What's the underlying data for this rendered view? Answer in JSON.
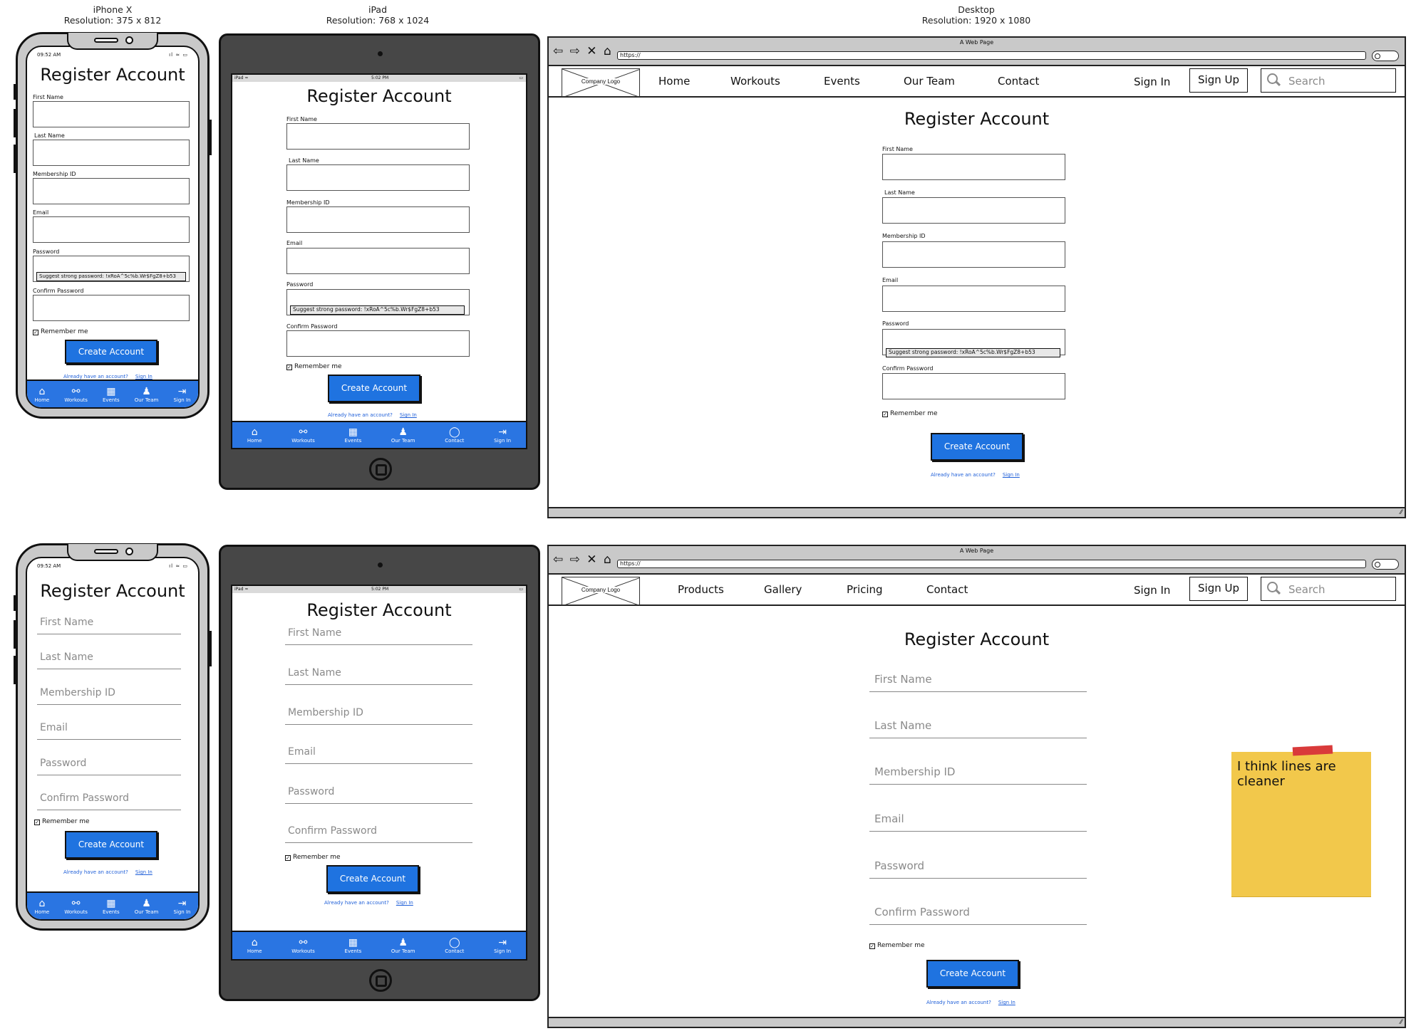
{
  "headers": {
    "iphone": {
      "name": "iPhone X",
      "res": "Resolution: 375 x 812"
    },
    "ipad": {
      "name": "iPad",
      "res": "Resolution: 768 x 1024"
    },
    "desktop": {
      "name": "Desktop",
      "res": "Resolution: 1920 x 1080"
    }
  },
  "form": {
    "title": "Register Account",
    "labels": [
      "First Name",
      "Last Name",
      "Membership ID",
      "Email",
      "Password",
      "Confirm Password"
    ],
    "password_suggestion": "Suggest strong password: !xRoA^5c%b.Wr$FgZ8+b53",
    "remember_me": "Remember me",
    "checkmark": "✓",
    "create_button": "Create Account",
    "already": "Already have an account?",
    "sign_in_link": "Sign In"
  },
  "phone_status": {
    "time": "09:52 AM",
    "icons": "ıl ≈ ▭"
  },
  "tablet_status": {
    "left": "iPad ≈",
    "time": "5:02 PM",
    "right": "▭"
  },
  "bottom_nav": {
    "phone": [
      {
        "icon": "home-icon",
        "glyph": "⌂",
        "label": "Home"
      },
      {
        "icon": "workouts-icon",
        "glyph": "⚯",
        "label": "Workouts"
      },
      {
        "icon": "calendar-icon",
        "glyph": "▦",
        "label": "Events"
      },
      {
        "icon": "team-icon",
        "glyph": "♟",
        "label": "Our Team"
      },
      {
        "icon": "sign-in-icon",
        "glyph": "⇥",
        "label": "Sign In"
      }
    ],
    "tablet": [
      {
        "icon": "home-icon",
        "glyph": "⌂",
        "label": "Home"
      },
      {
        "icon": "workouts-icon",
        "glyph": "⚯",
        "label": "Workouts"
      },
      {
        "icon": "calendar-icon",
        "glyph": "▦",
        "label": "Events"
      },
      {
        "icon": "team-icon",
        "glyph": "♟",
        "label": "Our Team"
      },
      {
        "icon": "chat-icon",
        "glyph": "◯",
        "label": "Contact"
      },
      {
        "icon": "sign-in-icon",
        "glyph": "⇥",
        "label": "Sign In"
      }
    ]
  },
  "browser": {
    "window_title": "A Web Page",
    "url": "https://",
    "nav_controls": "⇦ ⇨ ✕ ⌂",
    "logo_text": "Company Logo",
    "nav_top": [
      "Home",
      "Workouts",
      "Events",
      "Our Team",
      "Contact"
    ],
    "nav_bottom": [
      "Products",
      "Gallery",
      "Pricing",
      "Contact"
    ],
    "sign_in": "Sign In",
    "sign_up": "Sign Up",
    "search_placeholder": "Search",
    "resize_glyph": "⁄⁄"
  },
  "sticky_note": {
    "text": "I think lines are cleaner"
  },
  "colors": {
    "accent": "#1f73e0",
    "bar": "#2a75e2",
    "note": "#f2c84b",
    "tape": "#d93a3a"
  }
}
